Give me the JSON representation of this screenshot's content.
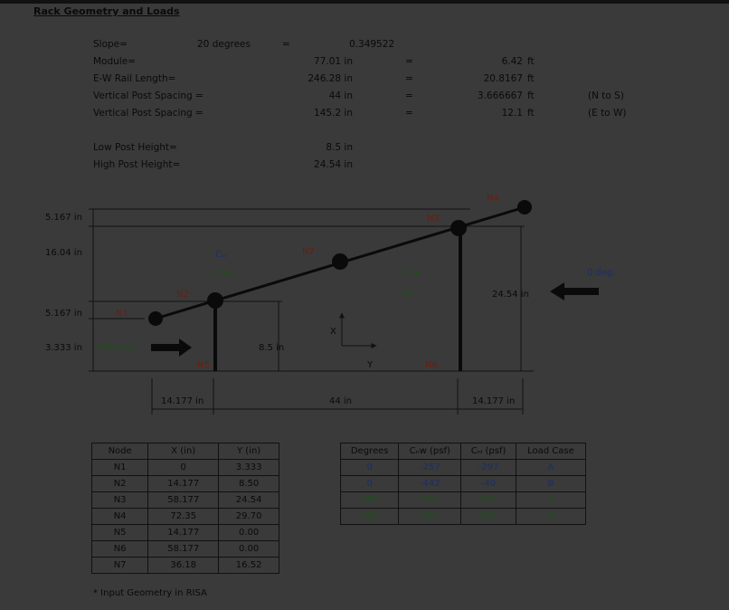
{
  "title": "Rack Geometry and Loads",
  "params": [
    {
      "label": "Slope=",
      "value": "20 degrees",
      "eq": "=",
      "value2": "0.349522",
      "unit2": "",
      "note": ""
    },
    {
      "label": "Module=",
      "value": "77.01 in",
      "eq": "=",
      "value2": "6.42",
      "unit2": "ft",
      "note": ""
    },
    {
      "label": "E-W Rail Length=",
      "value": "246.28 in",
      "eq": "=",
      "value2": "20.8167",
      "unit2": "ft",
      "note": ""
    },
    {
      "label": "Vertical Post Spacing =",
      "value": "44 in",
      "eq": "=",
      "value2": "3.666667",
      "unit2": "ft",
      "note": "(N to S)"
    },
    {
      "label": "Vertical Post Spacing =",
      "value": "145.2 in",
      "eq": "=",
      "value2": "12.1",
      "unit2": "ft",
      "note": "(E to W)"
    }
  ],
  "posts": [
    {
      "label": "Low Post Height=",
      "value": "8.5 in"
    },
    {
      "label": "High Post Height=",
      "value": "24.54 in"
    }
  ],
  "diagram": {
    "dims_left": [
      "5.167 in",
      "16.04 in",
      "5.167 in",
      "3.333 in"
    ],
    "dim_low_post": "8.5 in",
    "dim_high_post": "24.54 in",
    "dims_bottom": [
      "14.177 in",
      "44 in",
      "14.177 in"
    ],
    "nodes": [
      "N1",
      "N2",
      "N3",
      "N4",
      "N5",
      "N6",
      "N7"
    ],
    "coef_left": [
      "Cₙₗ",
      "Cₙw"
    ],
    "coef_right": [
      "Cₙw",
      "Cₙₗ"
    ],
    "wind_left": "180 deg.",
    "wind_right": "0 deg.",
    "axis_x": "X",
    "axis_y": "Y"
  },
  "node_table": {
    "headers": [
      "Node",
      "X (in)",
      "Y (in)"
    ],
    "rows": [
      [
        "N1",
        "0",
        "3.333"
      ],
      [
        "N2",
        "14.177",
        "8.50"
      ],
      [
        "N3",
        "58.177",
        "24.54"
      ],
      [
        "N4",
        "72.35",
        "29.70"
      ],
      [
        "N5",
        "14.177",
        "0.00"
      ],
      [
        "N6",
        "58.177",
        "0.00"
      ],
      [
        "N7",
        "36.18",
        "16.52"
      ]
    ]
  },
  "load_table": {
    "headers": [
      "Degrees",
      "Cₙw (psf)",
      "Cₙₗ (psf)",
      "Load Case"
    ],
    "rows": [
      [
        "0",
        "-257",
        "-297",
        "A"
      ],
      [
        "0",
        "-442",
        "-40",
        "B"
      ],
      [
        "180",
        "310",
        "343",
        "A"
      ],
      [
        "180",
        "409",
        "132",
        "B"
      ]
    ]
  },
  "footnote": "*  Input Geometry in RISA",
  "colors": {
    "node_label": "#6b1d10",
    "green": "#1f4f1a",
    "blue": "#1a2f66"
  }
}
